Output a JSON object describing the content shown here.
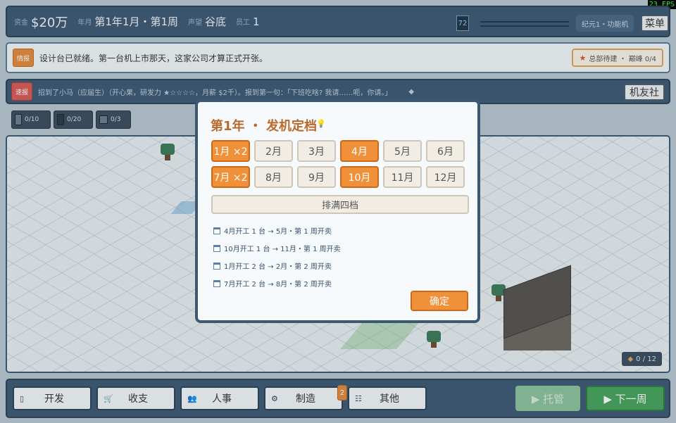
{
  "topbar": {
    "funds_label": "资金",
    "funds_value": "$20万",
    "date_label": "年月",
    "date_value": "第1年1月・第1周",
    "rep_label": "声望",
    "rep_value": "谷底",
    "staff_label": "员工",
    "staff_value": "1",
    "counter": "72",
    "era": "纪元1・功能机",
    "menu": "菜单"
  },
  "fps": "23 FPS",
  "intel": {
    "tag": "情报",
    "text": "设计台已就绪。第一台机上市那天，这家公司才算正式开张。",
    "goal_star": "★",
    "goal": "总部待建 ・ 巅峰 0/4"
  },
  "news": {
    "tag": "速报",
    "text": "招到了小马（应届生）（开心果，研发力 ★☆☆☆☆，月薪 $2千）。报到第一句：「下班吃啥? 我请……呃，你请。」",
    "diamond": "◆",
    "club": "机友社"
  },
  "inventory": [
    {
      "value": "0/10",
      "icon": "phone-basic-icon"
    },
    {
      "value": "0/20",
      "icon": "phone-smart-icon"
    },
    {
      "value": "0/3",
      "icon": "chip-icon"
    }
  ],
  "game": {
    "gem": "◆",
    "counter": "0 / 12"
  },
  "nav": [
    {
      "icon": "▯",
      "label": "开发"
    },
    {
      "icon": "🛒",
      "label": "收支"
    },
    {
      "icon": "👥",
      "label": "人事"
    },
    {
      "icon": "⚙",
      "label": "制造",
      "badge": "2"
    },
    {
      "icon": "☷",
      "label": "其他"
    }
  ],
  "auto_label": "▶ 托管",
  "next_label": "▶ 下一周",
  "modal": {
    "title": "第1年 ・ 发机定档",
    "bulb": "💡",
    "months": [
      {
        "label": "1月 ×2",
        "selected": true
      },
      {
        "label": "2月",
        "selected": false
      },
      {
        "label": "3月",
        "selected": false
      },
      {
        "label": "4月",
        "selected": true
      },
      {
        "label": "5月",
        "selected": false
      },
      {
        "label": "6月",
        "selected": false
      },
      {
        "label": "7月 ×2",
        "selected": true
      },
      {
        "label": "8月",
        "selected": false
      },
      {
        "label": "9月",
        "selected": false
      },
      {
        "label": "10月",
        "selected": true
      },
      {
        "label": "11月",
        "selected": false
      },
      {
        "label": "12月",
        "selected": false
      }
    ],
    "fill_label": "排满四档",
    "schedule": [
      "4月开工 1 台 → 5月・第 1 周开卖",
      "10月开工 1 台 → 11月・第 1 周开卖",
      "1月开工 2 台 → 2月・第 2 周开卖",
      "7月开工 2 台 → 8月・第 2 周开卖"
    ],
    "confirm": "确定"
  }
}
